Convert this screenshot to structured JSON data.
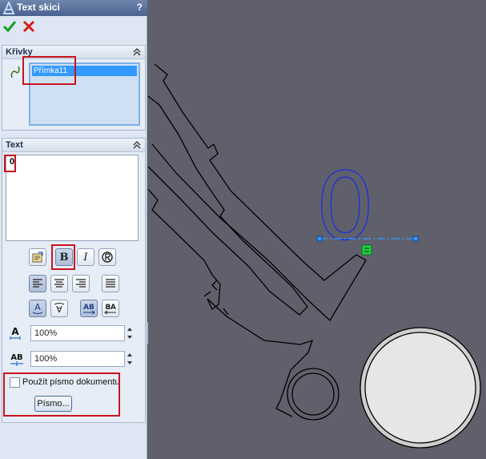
{
  "panel": {
    "title": "Text skici",
    "help": "?",
    "ok_icon": "checkmark-icon",
    "cancel_icon": "close-icon"
  },
  "curves": {
    "heading": "Křivky",
    "items": [
      "Přímka11"
    ]
  },
  "text_group": {
    "heading": "Text",
    "content": "0",
    "bold": true,
    "italic": false,
    "alignment": "left",
    "width_factor": "100%",
    "spacing": "100%",
    "use_doc_font_label": "Použít písmo dokumentu",
    "use_doc_font_checked": false,
    "font_button": "Písmo..."
  },
  "canvas": {
    "sketch_text": "0",
    "colors": {
      "background": "#5f606b",
      "text": "#1f32d6",
      "line": "#000000",
      "handle": "#3399ff",
      "relation": "#1fd142",
      "circle_fill": "#e6e6e6"
    }
  }
}
